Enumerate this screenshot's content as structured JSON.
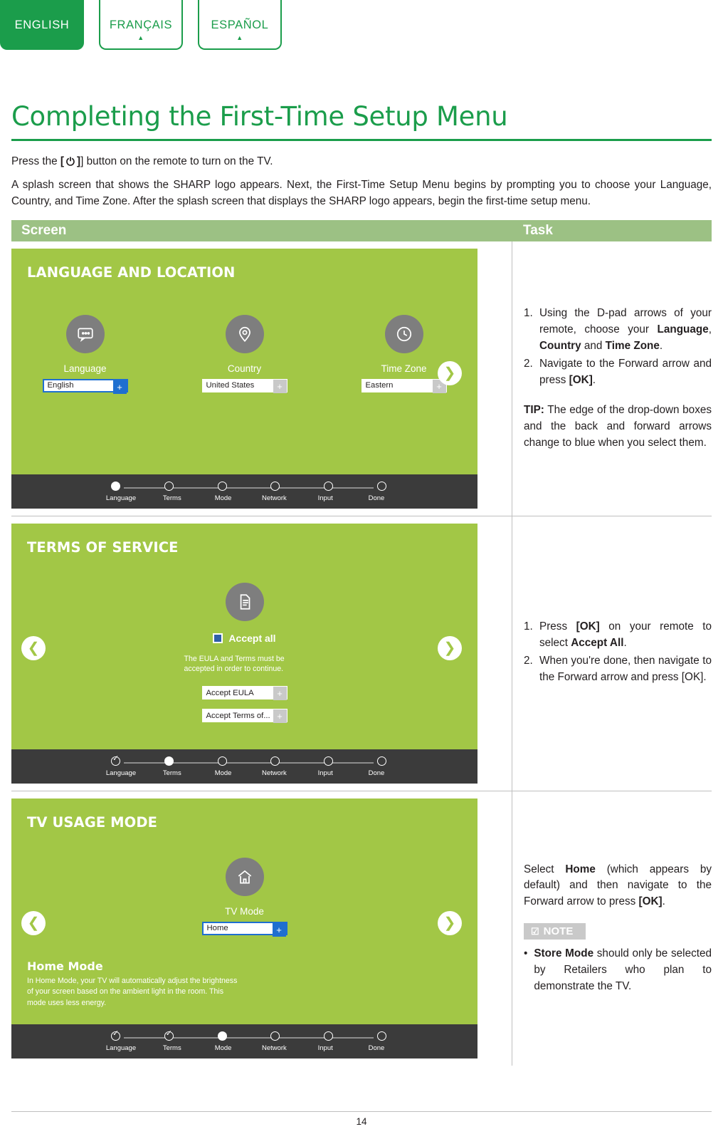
{
  "langTabs": [
    {
      "label": "ENGLISH",
      "active": true
    },
    {
      "label": "FRANÇAIS",
      "active": false
    },
    {
      "label": "ESPAÑOL",
      "active": false
    }
  ],
  "page": {
    "title": "Completing the First-Time Setup Menu",
    "intro1_pre": "Press the ",
    "intro1_bracket_open": "[",
    "intro1_power_glyph": "⏻",
    "intro1_bracket_close": "]",
    "intro1_post": "] button on the remote to turn on the TV.",
    "intro2": "A splash screen that shows the SHARP logo appears. Next, the First-Time Setup Menu begins by prompting you to choose your Language, Country, and Time Zone. After the splash screen that displays the SHARP logo appears, begin the first-time setup menu.",
    "footer_page": "14"
  },
  "table": {
    "headers": {
      "screen": "Screen",
      "task": "Task"
    }
  },
  "progress": {
    "labels": [
      "Language",
      "Terms",
      "Mode",
      "Network",
      "Input",
      "Done"
    ]
  },
  "screen1": {
    "title": "LANGUAGE AND LOCATION",
    "icons": {
      "language": "speech-bubble-icon",
      "country": "location-pin-icon",
      "timezone": "clock-icon"
    },
    "options": [
      {
        "label": "Language",
        "value": "English",
        "plus": "+"
      },
      {
        "label": "Country",
        "value": "United States",
        "plus": "+"
      },
      {
        "label": "Time Zone",
        "value": "Eastern",
        "plus": "+"
      }
    ],
    "forward_arrow": "❯"
  },
  "screen2": {
    "title": "TERMS OF SERVICE",
    "icon": "document-icon",
    "accept_all": "Accept all",
    "note": "The EULA and Terms must be accepted in order to continue.",
    "dropdowns": [
      {
        "value": "Accept EULA",
        "plus": "+"
      },
      {
        "value": "Accept Terms of...",
        "plus": "+"
      }
    ],
    "back_arrow": "❮",
    "forward_arrow": "❯"
  },
  "screen3": {
    "title": "TV USAGE MODE",
    "icon": "home-icon",
    "mode_label": "TV Mode",
    "mode_value": "Home",
    "mode_plus": "+",
    "home_mode_heading": "Home Mode",
    "home_mode_text": "In Home Mode, your TV will automatically adjust the brightness of your screen based on the ambient light in the room. This mode uses less energy.",
    "back_arrow": "❮",
    "forward_arrow": "❯"
  },
  "task1": {
    "items": [
      {
        "num": "1.",
        "html": "Using the D-pad arrows of your remote, choose your <b>Language</b>, <b>Country</b> and <b>Time Zone</b>."
      },
      {
        "num": "2.",
        "html": "Navigate to the Forward arrow and press <b>[OK]</b>."
      }
    ],
    "tip": "<b>TIP:</b> The edge of the drop-down boxes and the back and forward arrows change to blue when you select them."
  },
  "task2": {
    "items": [
      {
        "num": "1.",
        "html": "Press <b>[OK]</b> on your remote to select <b>Accept All</b>."
      },
      {
        "num": "2.",
        "html": "When you're done, then navigate to the Forward arrow and press [OK]."
      }
    ]
  },
  "task3": {
    "lead": "Select <b>Home</b> (which appears by default) and then navigate to the Forward arrow to press <b>[OK]</b>.",
    "note_label": "NOTE",
    "note_icon": "note-check-icon",
    "bullet": "<b>Store Mode</b> should only be selected by Retailers who plan to demonstrate the TV.",
    "bullet_dot": "•"
  }
}
